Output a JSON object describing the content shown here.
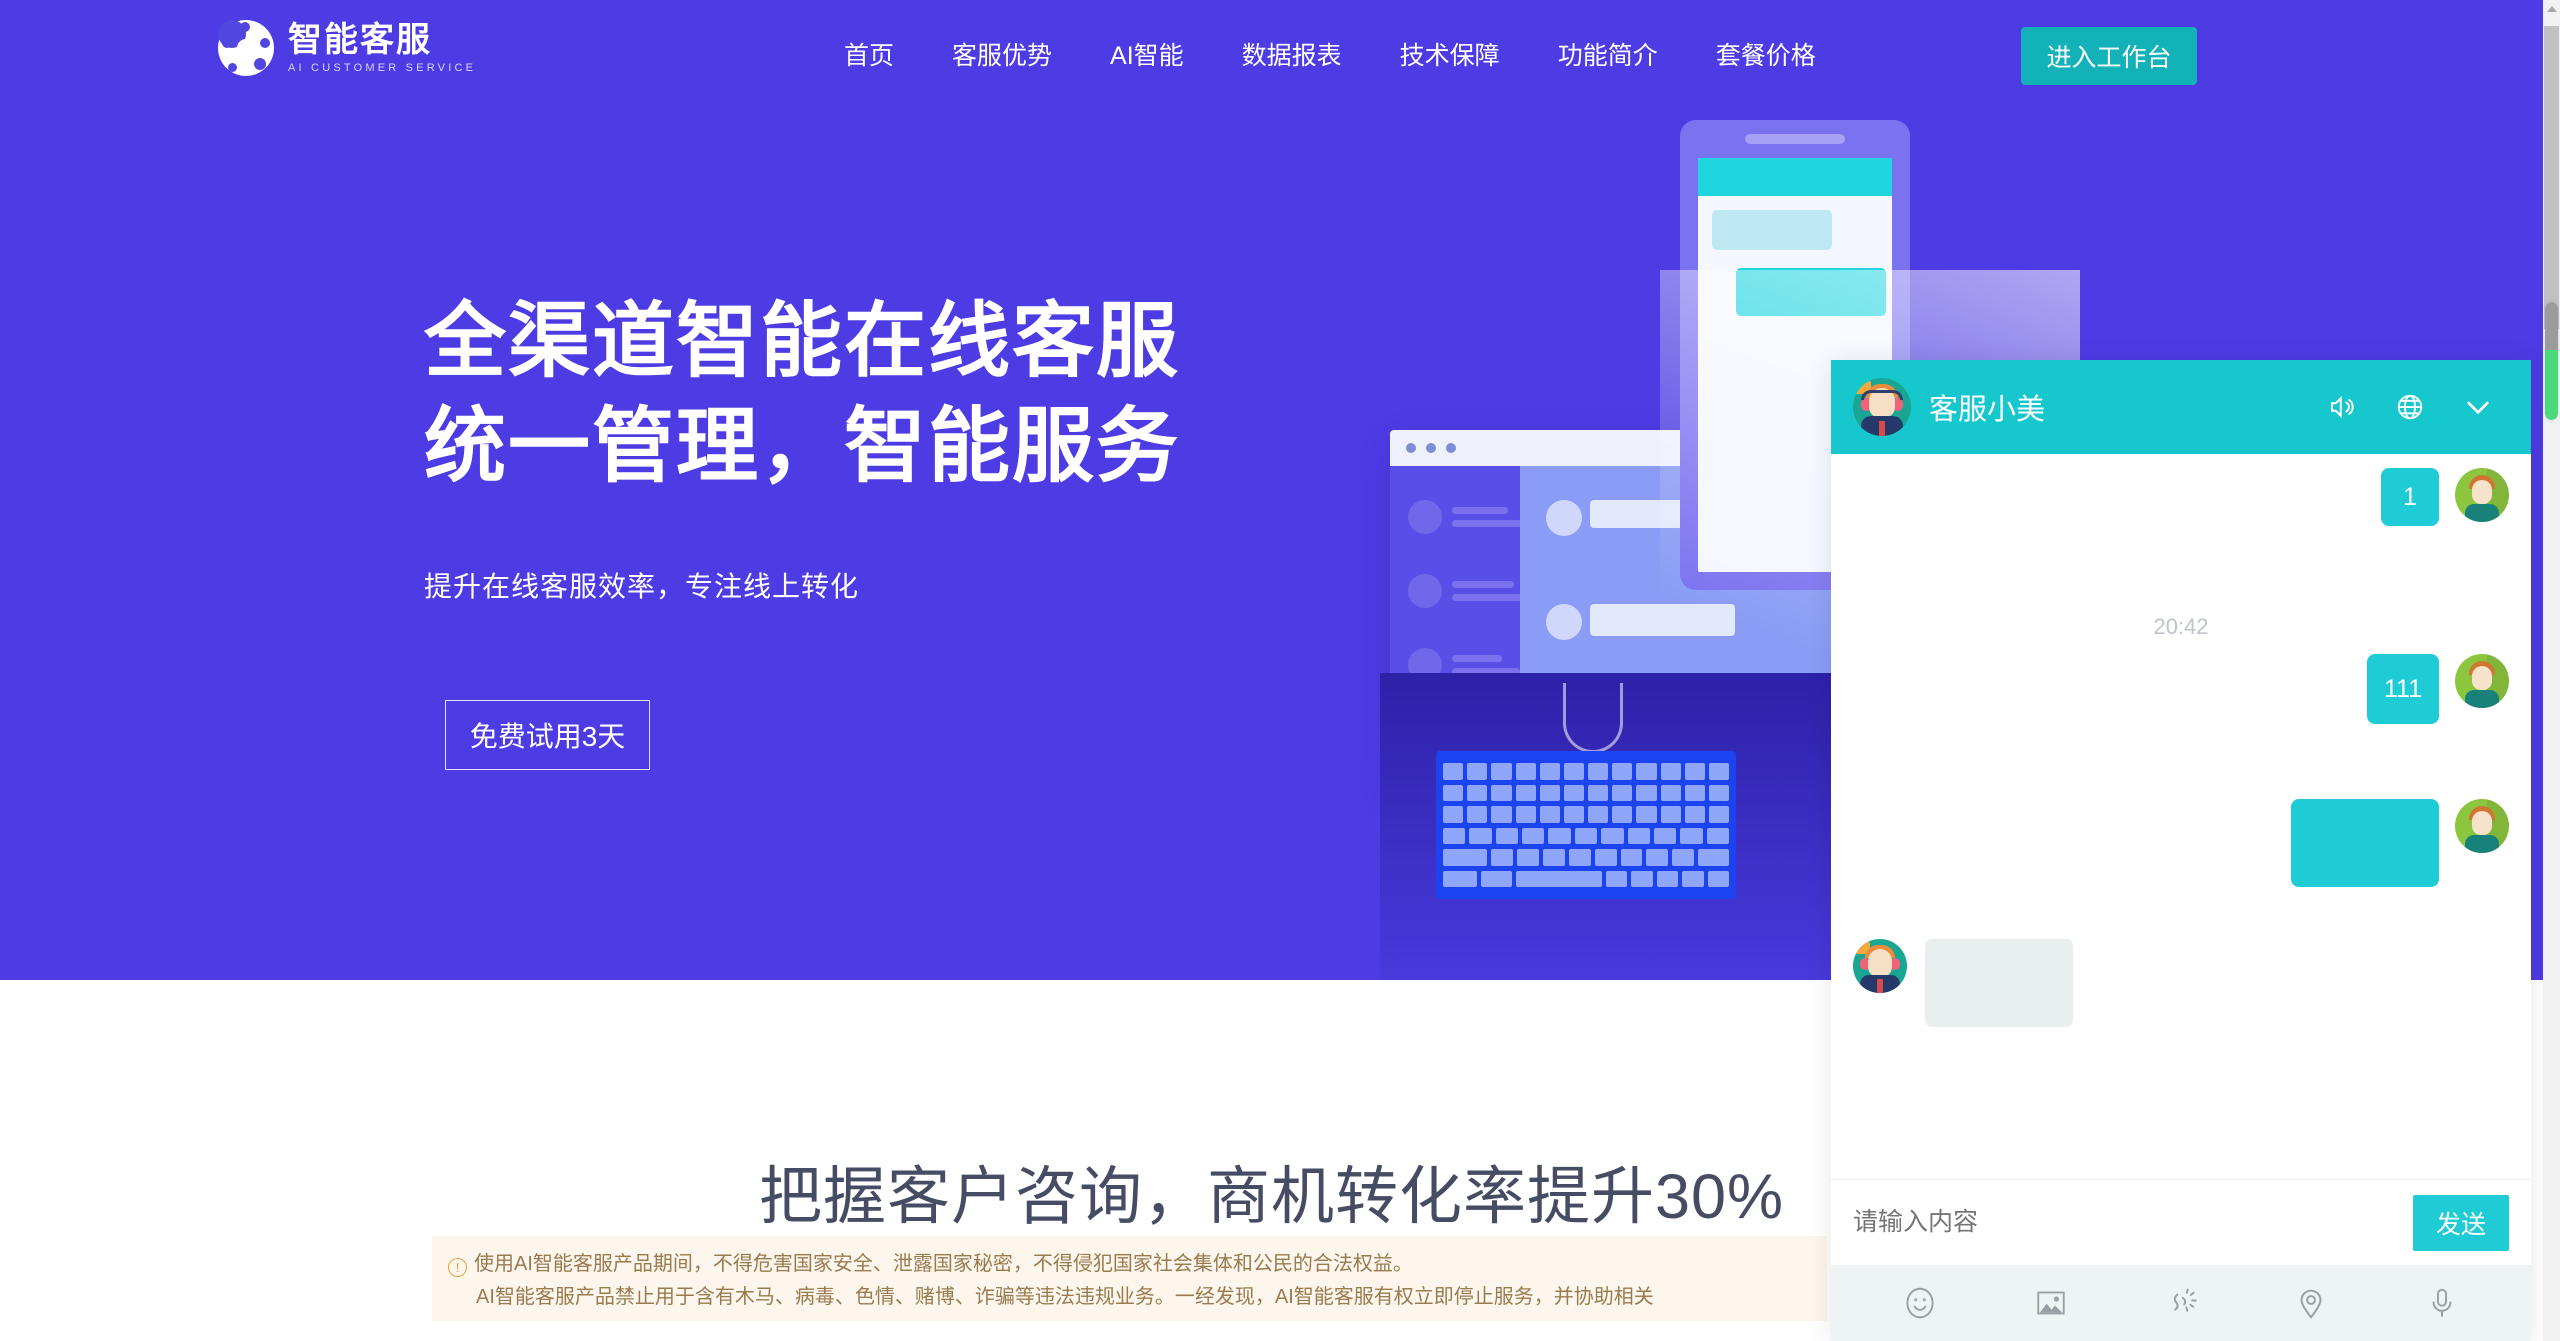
{
  "brand": {
    "name_cn": "智能客服",
    "name_en": "AI CUSTOMER SERVICE",
    "logo_icon": "at-network-icon",
    "primary_color": "#4D3BE3",
    "accent_color": "#16C7CD"
  },
  "nav": {
    "links": [
      {
        "label": "首页"
      },
      {
        "label": "客服优势"
      },
      {
        "label": "AI智能"
      },
      {
        "label": "数据报表"
      },
      {
        "label": "技术保障"
      },
      {
        "label": "功能简介"
      },
      {
        "label": "套餐价格"
      }
    ],
    "cta_label": "进入工作台"
  },
  "hero": {
    "title": "全渠道智能在线客服\n统一管理，智能服务",
    "subtitle": "提升在线客服效率，专注线上转化",
    "button_label": "免费试用3天"
  },
  "section2": {
    "heading": "把握客户咨询，商机转化率提升30%"
  },
  "notice": {
    "icon": "warning-circle-icon",
    "line1": "使用AI智能客服产品期间，不得危害国家安全、泄露国家秘密，不得侵犯国家社会集体和公民的合法权益。",
    "line2": "AI智能客服产品禁止用于含有木马、病毒、色情、赌博、诈骗等违法违规业务。一经发现，AI智能客服有权立即停止服务，并协助相关"
  },
  "chat": {
    "header": {
      "agent_name": "客服小美",
      "avatar_icon": "agent-avatar-icon",
      "actions": [
        {
          "name": "sound-icon"
        },
        {
          "name": "globe-icon"
        },
        {
          "name": "chevron-down-icon"
        }
      ]
    },
    "messages": [
      {
        "side": "out",
        "text": "1",
        "author_icon": "customer-avatar-icon"
      },
      {
        "side": "separator",
        "text": "20:42"
      },
      {
        "side": "out",
        "text": "111",
        "author_icon": "customer-avatar-icon"
      },
      {
        "side": "out",
        "text": "",
        "author_icon": "customer-avatar-icon"
      },
      {
        "side": "in",
        "text": "",
        "author_icon": "agent-avatar-icon"
      }
    ],
    "input": {
      "placeholder": "请输入内容",
      "value": "",
      "send_label": "发送"
    },
    "tools": [
      {
        "name": "emoji-icon"
      },
      {
        "name": "image-icon"
      },
      {
        "name": "shake-icon"
      },
      {
        "name": "location-icon"
      },
      {
        "name": "microphone-icon"
      }
    ]
  }
}
